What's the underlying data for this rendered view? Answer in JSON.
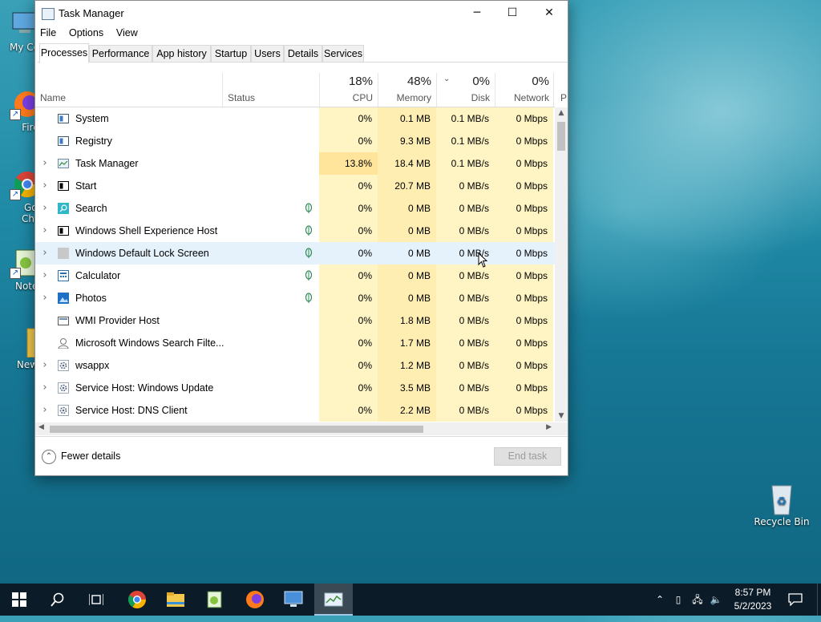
{
  "desktop": {
    "icons_left": [
      {
        "name": "my-computer",
        "label": "My Cor"
      },
      {
        "name": "firefox",
        "label": "Firef"
      },
      {
        "name": "google-chrome",
        "label": "Goo",
        "label2": "Chro"
      },
      {
        "name": "notepad",
        "label": "Notep"
      },
      {
        "name": "new-folder",
        "label": "New f"
      }
    ],
    "recycle_bin": "Recycle Bin"
  },
  "window": {
    "title": "Task Manager",
    "controls": {
      "minimize": "─",
      "maximize": "☐",
      "close": "✕"
    },
    "menu": [
      "File",
      "Options",
      "View"
    ],
    "tabs": [
      "Processes",
      "Performance",
      "App history",
      "Startup",
      "Users",
      "Details",
      "Services"
    ],
    "active_tab": "Processes",
    "columns": {
      "name": "Name",
      "status": "Status",
      "cpu": {
        "pct": "18%",
        "label": "CPU"
      },
      "memory": {
        "pct": "48%",
        "label": "Memory"
      },
      "disk": {
        "pct": "0%",
        "label": "Disk"
      },
      "network": {
        "pct": "0%",
        "label": "Network"
      },
      "power_clip": "P"
    },
    "processes": [
      {
        "name": "System",
        "expand": "",
        "cpu": "0%",
        "mem": "0.1 MB",
        "disk": "0.1 MB/s",
        "net": "0 Mbps",
        "suspended": false
      },
      {
        "name": "Registry",
        "expand": "",
        "cpu": "0%",
        "mem": "9.3 MB",
        "disk": "0.1 MB/s",
        "net": "0 Mbps",
        "suspended": false
      },
      {
        "name": "Task Manager",
        "expand": "›",
        "cpu": "13.8%",
        "mem": "18.4 MB",
        "disk": "0.1 MB/s",
        "net": "0 Mbps",
        "suspended": false
      },
      {
        "name": "Start",
        "expand": "›",
        "cpu": "0%",
        "mem": "20.7 MB",
        "disk": "0 MB/s",
        "net": "0 Mbps",
        "suspended": false
      },
      {
        "name": "Search",
        "expand": "›",
        "cpu": "0%",
        "mem": "0 MB",
        "disk": "0 MB/s",
        "net": "0 Mbps",
        "suspended": true
      },
      {
        "name": "Windows Shell Experience Host",
        "expand": "›",
        "cpu": "0%",
        "mem": "0 MB",
        "disk": "0 MB/s",
        "net": "0 Mbps",
        "suspended": true
      },
      {
        "name": "Windows Default Lock Screen",
        "expand": "›",
        "cpu": "0%",
        "mem": "0 MB",
        "disk": "0 MB/s",
        "net": "0 Mbps",
        "suspended": true
      },
      {
        "name": "Calculator",
        "expand": "›",
        "cpu": "0%",
        "mem": "0 MB",
        "disk": "0 MB/s",
        "net": "0 Mbps",
        "suspended": true
      },
      {
        "name": "Photos",
        "expand": "›",
        "cpu": "0%",
        "mem": "0 MB",
        "disk": "0 MB/s",
        "net": "0 Mbps",
        "suspended": true
      },
      {
        "name": "WMI Provider Host",
        "expand": "",
        "cpu": "0%",
        "mem": "1.8 MB",
        "disk": "0 MB/s",
        "net": "0 Mbps",
        "suspended": false
      },
      {
        "name": "Microsoft Windows Search Filte...",
        "expand": "",
        "cpu": "0%",
        "mem": "1.7 MB",
        "disk": "0 MB/s",
        "net": "0 Mbps",
        "suspended": false
      },
      {
        "name": "wsappx",
        "expand": "›",
        "cpu": "0%",
        "mem": "1.2 MB",
        "disk": "0 MB/s",
        "net": "0 Mbps",
        "suspended": false
      },
      {
        "name": "Service Host: Windows Update",
        "expand": "›",
        "cpu": "0%",
        "mem": "3.5 MB",
        "disk": "0 MB/s",
        "net": "0 Mbps",
        "suspended": false
      },
      {
        "name": "Service Host: DNS Client",
        "expand": "›",
        "cpu": "0%",
        "mem": "2.2 MB",
        "disk": "0 MB/s",
        "net": "0 Mbps",
        "suspended": false
      }
    ],
    "hovered_row": "Windows Default Lock Screen",
    "footer": {
      "fewer_details": "Fewer details",
      "end_task": "End task"
    },
    "colors": {
      "cpu_fill": "#fff4c4",
      "mem_fill": "#ffeeb2",
      "cpu_hot": "#ffe59b",
      "hover": "#e5f1fb"
    }
  },
  "taskbar": {
    "items": [
      "start-icon",
      "search-icon",
      "task-view-icon",
      "chrome-icon",
      "file-explorer-icon",
      "notepad-plus-icon",
      "firefox-icon",
      "remote-desktop-icon",
      "task-manager-icon"
    ],
    "active": "task-manager-icon",
    "time": "8:57 PM",
    "date": "5/2/2023"
  }
}
